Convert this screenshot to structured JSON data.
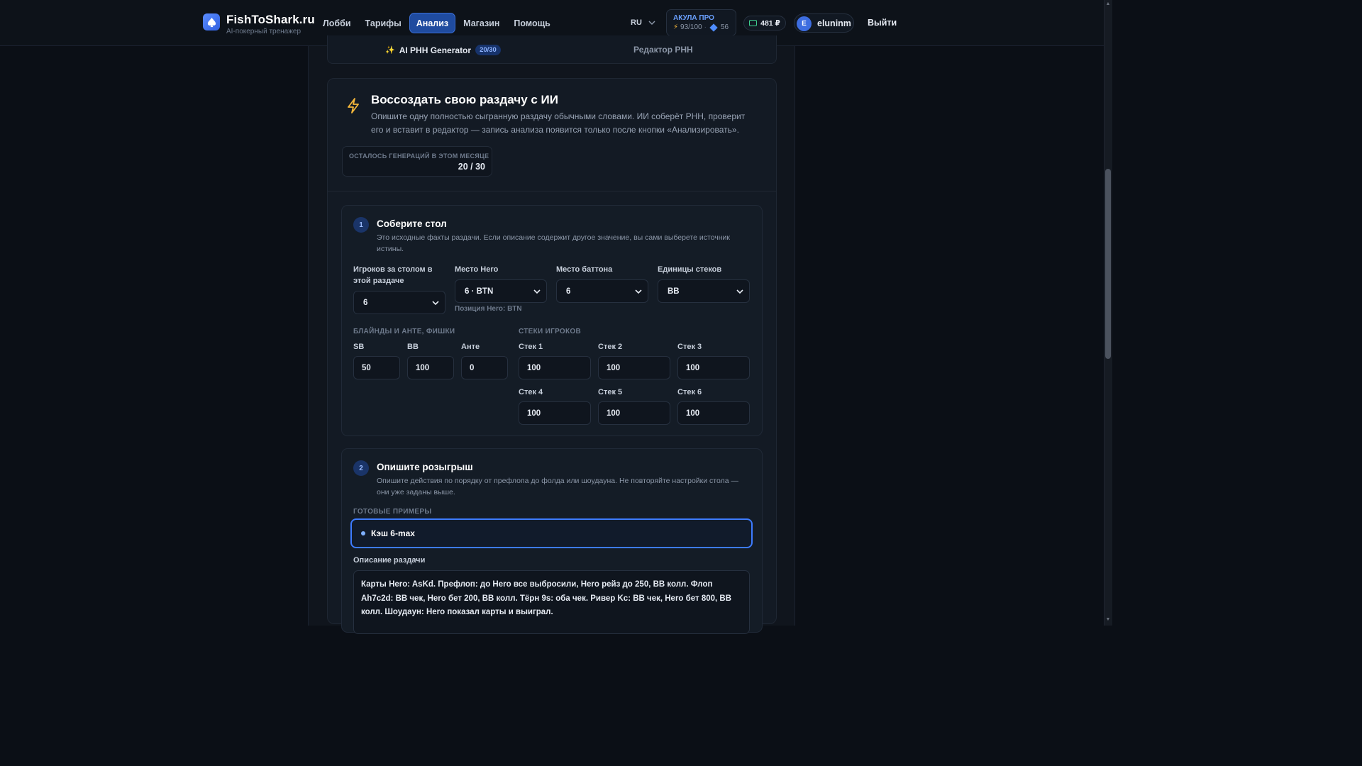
{
  "header": {
    "brand": "FishToShark.ru",
    "tagline": "AI-покерный тренажер",
    "nav": [
      "Лобби",
      "Тарифы",
      "Анализ",
      "Магазин",
      "Помощь"
    ],
    "active_nav": "Анализ",
    "lang": "RU",
    "plan_title": "АКУЛА ПРО",
    "plan_energy": "93/100",
    "plan_gems": "56",
    "balance": "481 ₽",
    "avatar_letter": "E",
    "username": "eluninm",
    "logout": "Выйти"
  },
  "mode_tabs": {
    "ai_label": "AI PHH Generator",
    "ai_count": "20/30",
    "editor_label": "Редактор PHH"
  },
  "hero": {
    "title": "Воссоздать свою раздачу с ИИ",
    "description": "Опишите одну полностью сыгранную раздачу обычными словами. ИИ соберёт PHH, проверит его и вставит в редактор — запись анализа появится только после кнопки «Анализировать».",
    "quota_label": "ОСТАЛОСЬ ГЕНЕРАЦИЙ В ЭТОМ МЕСЯЦЕ",
    "quota_value": "20 / 30"
  },
  "step1": {
    "number": "1",
    "title": "Соберите стол",
    "description": "Это исходные факты раздачи. Если описание содержит другое значение, вы сами выберете источник истины.",
    "players_label": "Игроков за столом в этой раздаче",
    "players_value": "6",
    "hero_seat_label": "Место Hero",
    "hero_seat_value": "6 · BTN",
    "hero_position_hint": "Позиция Hero: BTN",
    "button_seat_label": "Место баттона",
    "button_seat_value": "6",
    "stack_units_label": "Единицы стеков",
    "stack_units_value": "BB",
    "blinds_section": "БЛАЙНДЫ И АНТЕ, ФИШКИ",
    "stacks_section": "СТЕКИ ИГРОКОВ",
    "sb_label": "SB",
    "sb_value": "50",
    "bb_label": "BB",
    "bb_value": "100",
    "ante_label": "Анте",
    "ante_value": "0",
    "stacks": [
      {
        "label": "Стек 1",
        "value": "100"
      },
      {
        "label": "Стек 2",
        "value": "100"
      },
      {
        "label": "Стек 3",
        "value": "100"
      },
      {
        "label": "Стек 4",
        "value": "100"
      },
      {
        "label": "Стек 5",
        "value": "100"
      },
      {
        "label": "Стек 6",
        "value": "100"
      }
    ]
  },
  "step2": {
    "number": "2",
    "title": "Опишите розыгрыш",
    "description": "Опишите действия по порядку от префлопа до фолда или шоудауна. Не повторяйте настройки стола — они уже заданы выше.",
    "examples_label": "ГОТОВЫЕ ПРИМЕРЫ",
    "example": "Кэш 6-max",
    "hand_label": "Описание раздачи",
    "hand_text": "Карты Hero: AsKd. Префлоп: до Hero все выбросили, Hero рейз до 250, BB колл. Флоп Ah7c2d: BB чек, Hero бет 200, BB колл. Тёрн 9s: оба чек. Ривер Kc: BB чек, Hero бет 800, BB колл. Шоудаун: Hero показал карты и выиграл."
  },
  "colors": {
    "accent": "#3d7bff",
    "background": "#0b0f16",
    "card": "#141c26",
    "warning_bolt": "#f5b73b"
  }
}
